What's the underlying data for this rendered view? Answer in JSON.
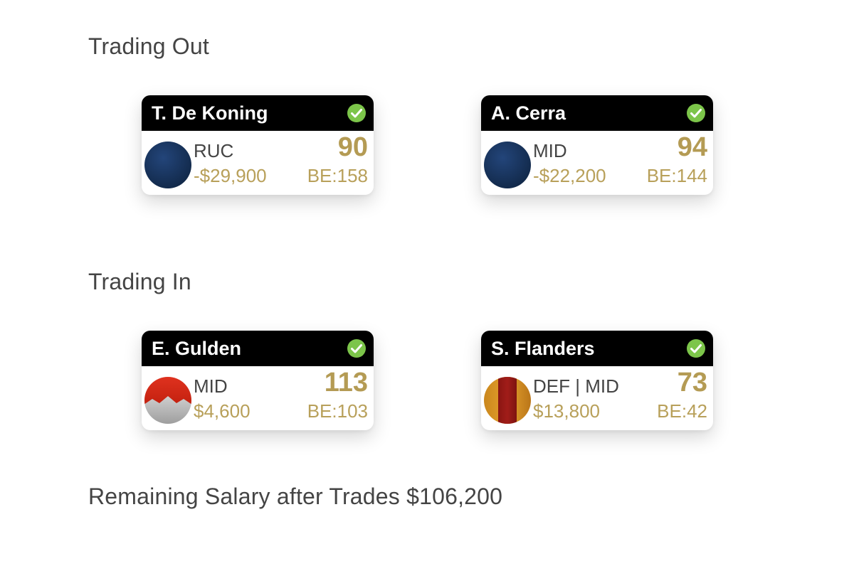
{
  "trading_out": {
    "title": "Trading Out",
    "players": [
      {
        "name": "T. De Koning",
        "position": "RUC",
        "price_change": "-$29,900",
        "score": "90",
        "breakeven": "BE:158",
        "guernsey_icon": "navy-guernsey-icon"
      },
      {
        "name": "A. Cerra",
        "position": "MID",
        "price_change": "-$22,200",
        "score": "94",
        "breakeven": "BE:144",
        "guernsey_icon": "navy-guernsey-icon"
      }
    ]
  },
  "trading_in": {
    "title": "Trading In",
    "players": [
      {
        "name": "E. Gulden",
        "position": "MID",
        "price_change": "$4,600",
        "score": "113",
        "breakeven": "BE:103",
        "guernsey_icon": "red-white-chevron-guernsey-icon"
      },
      {
        "name": "S. Flanders",
        "position": "DEF | MID",
        "price_change": "$13,800",
        "score": "73",
        "breakeven": "BE:42",
        "guernsey_icon": "gold-red-stripe-guernsey-icon"
      }
    ]
  },
  "summary": {
    "remaining_salary": "Remaining Salary after Trades $106,200"
  },
  "colors": {
    "header_bg": "#000000",
    "accent_gold": "#b49b54",
    "check_green": "#7cc54a",
    "navy": "#1a355e"
  }
}
